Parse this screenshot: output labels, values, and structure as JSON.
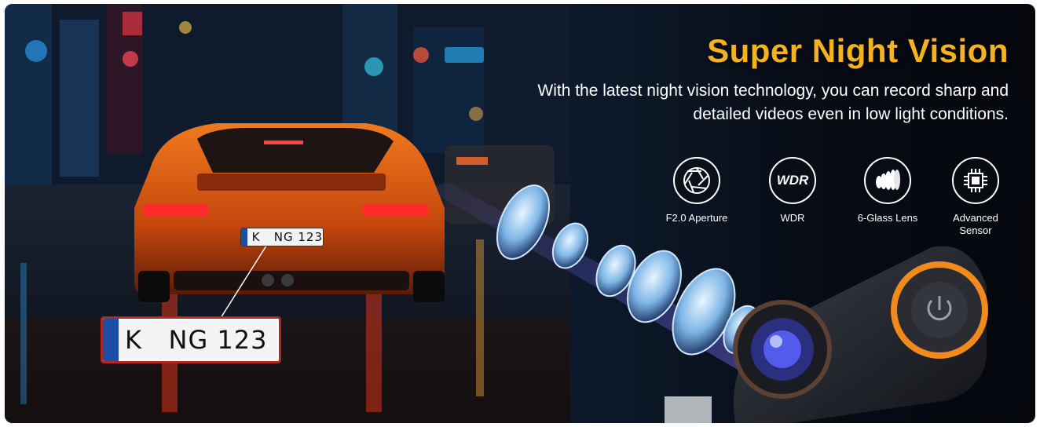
{
  "banner": {
    "title": "Super Night Vision",
    "subtitle": "With the latest night vision technology, you can record sharp and detailed videos even in low light conditions."
  },
  "features": [
    {
      "icon": "aperture-icon",
      "label": "F2.0 Aperture"
    },
    {
      "icon": "wdr-icon",
      "icon_text": "WDR",
      "label": "WDR"
    },
    {
      "icon": "lens-stack-icon",
      "label": "6-Glass Lens"
    },
    {
      "icon": "chip-icon",
      "label": "Advanced\nSensor"
    }
  ],
  "plate": {
    "small_text": "K   NG 123",
    "big_text": "K   NG 123"
  },
  "colors": {
    "title": "#f5b21f",
    "subtitle": "#ffffff",
    "plate_border": "#b3261e",
    "accent_orange": "#f08a1d",
    "beam": "#6a5cff"
  }
}
